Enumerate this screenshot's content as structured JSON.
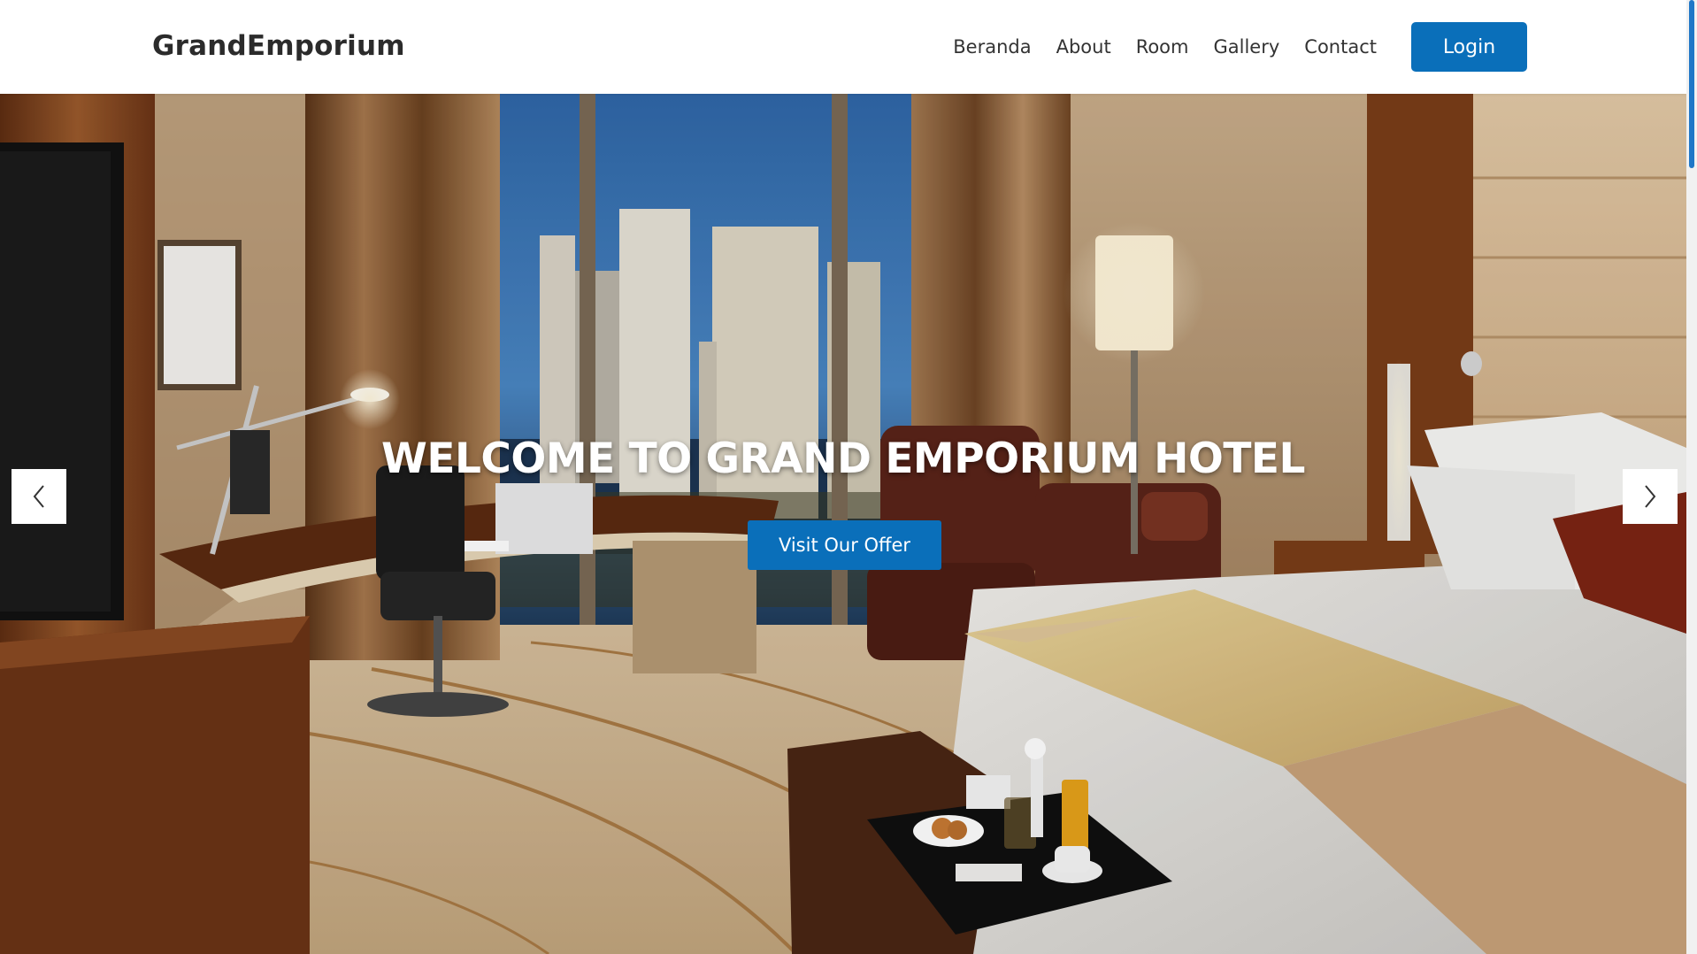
{
  "navbar": {
    "brand": "GrandEmporium",
    "links": [
      {
        "label": "Beranda"
      },
      {
        "label": "About"
      },
      {
        "label": "Room"
      },
      {
        "label": "Gallery"
      },
      {
        "label": "Contact"
      }
    ],
    "login_label": "Login"
  },
  "hero": {
    "title": "WELCOME TO GRAND EMPORIUM HOTEL",
    "cta_label": "Visit Our Offer",
    "prev_icon": "chevron-left-icon",
    "next_icon": "chevron-right-icon",
    "image": "hotel-room-photo"
  },
  "colors": {
    "primary": "#0a6fba",
    "brand_text": "#2b2b2b",
    "nav_text": "#333333",
    "hero_text": "#ffffff"
  }
}
